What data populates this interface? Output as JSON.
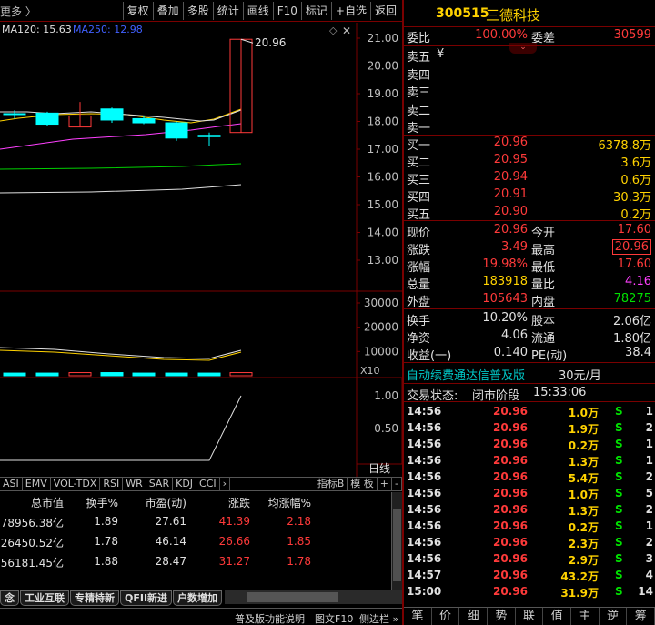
{
  "toolbar": {
    "more": "更多 〉",
    "buttons": [
      "复权",
      "叠加",
      "多股",
      "统计",
      "画线",
      "F10",
      "标记",
      "+自选",
      "返回"
    ]
  },
  "chart": {
    "ma120_label": "MA120: 15.63",
    "ma250_label": "MA250: 12.98",
    "price_axis": [
      "21.00",
      "20.00",
      "19.00",
      "18.00",
      "17.00",
      "16.00",
      "15.00",
      "14.00",
      "13.00"
    ],
    "high_marker": "20.96",
    "volume_axis": [
      "30000",
      "20000",
      "10000"
    ],
    "volume_unit": "X10",
    "indicator_axis": [
      "1.00",
      "0.50"
    ],
    "weekly_label": "日线",
    "colors": {
      "up": "#ff3a3a",
      "down": "#00ffff",
      "ma_white": "#e0e0e0",
      "ma_yellow": "#ffd200",
      "ma_magenta": "#ff40ff",
      "ma_green": "#00d000",
      "grid": "#7a0000"
    }
  },
  "indicator_tabs": [
    "ASI",
    "EMV",
    "VOL-TDX",
    "RSI",
    "WR",
    "SAR",
    "KDJ",
    "CCI",
    "›",
    "指标B",
    "模 板",
    "+",
    "-"
  ],
  "sector_table": {
    "headers": [
      "总市值",
      "换手%",
      "市盈(动)",
      "涨跌",
      "均涨幅%"
    ],
    "rows": [
      [
        "78956.38亿",
        "1.89",
        "27.61",
        "41.39",
        "2.18"
      ],
      [
        "26450.52亿",
        "1.78",
        "46.14",
        "26.66",
        "1.85"
      ],
      [
        "56181.45亿",
        "1.88",
        "28.47",
        "31.27",
        "1.78"
      ]
    ]
  },
  "sector_tabs": [
    "念",
    "工业互联",
    "专精特新",
    "QFII新进",
    "户数增加"
  ],
  "status_bar": {
    "left": "普及版功能说明",
    "mid": "图文F10",
    "right": "侧边栏 »"
  },
  "quote": {
    "code": "300515",
    "name": "三德科技",
    "weibi_label": "委比",
    "weibi": "100.00%",
    "weicha_label": "委差",
    "weicha": "30599",
    "sell_labels": [
      "卖五",
      "卖四",
      "卖三",
      "卖二",
      "卖一"
    ],
    "sell_extra": "¥",
    "buy": [
      {
        "label": "买一",
        "price": "20.96",
        "vol": "6378.8万"
      },
      {
        "label": "买二",
        "price": "20.95",
        "vol": "3.6万"
      },
      {
        "label": "买三",
        "price": "20.94",
        "vol": "0.6万"
      },
      {
        "label": "买四",
        "price": "20.91",
        "vol": "30.3万"
      },
      {
        "label": "买五",
        "price": "20.90",
        "vol": "0.2万"
      }
    ],
    "stats": [
      {
        "l1": "现价",
        "v1": "20.96",
        "l2": "今开",
        "v2": "17.60"
      },
      {
        "l1": "涨跌",
        "v1": "3.49",
        "l2": "最高",
        "v2": "20.96"
      },
      {
        "l1": "涨幅",
        "v1": "19.98%",
        "l2": "最低",
        "v2": "17.60"
      },
      {
        "l1": "总量",
        "v1": "183918",
        "l2": "量比",
        "v2": "4.16"
      },
      {
        "l1": "外盘",
        "v1": "105643",
        "l2": "内盘",
        "v2": "78275"
      }
    ],
    "fund": [
      {
        "l1": "换手",
        "v1": "10.20%",
        "l2": "股本",
        "v2": "2.06亿"
      },
      {
        "l1": "净资",
        "v1": "4.06",
        "l2": "流通",
        "v2": "1.80亿"
      },
      {
        "l1": "收益(一)",
        "v1": "0.140",
        "l2": "PE(动)",
        "v2": "38.4"
      }
    ],
    "ad_text": "自动续费通达信普及版",
    "ad_price": "30元/月",
    "trade_status_label": "交易状态:",
    "trade_status": "闭市阶段",
    "trade_time": "15:33:06"
  },
  "ticks": [
    [
      "14:56",
      "20.96",
      "1.0万",
      "S",
      "1"
    ],
    [
      "14:56",
      "20.96",
      "1.9万",
      "S",
      "2"
    ],
    [
      "14:56",
      "20.96",
      "0.2万",
      "S",
      "1"
    ],
    [
      "14:56",
      "20.96",
      "1.3万",
      "S",
      "1"
    ],
    [
      "14:56",
      "20.96",
      "5.4万",
      "S",
      "2"
    ],
    [
      "14:56",
      "20.96",
      "1.0万",
      "S",
      "5"
    ],
    [
      "14:56",
      "20.96",
      "1.3万",
      "S",
      "2"
    ],
    [
      "14:56",
      "20.96",
      "0.2万",
      "S",
      "1"
    ],
    [
      "14:56",
      "20.96",
      "2.3万",
      "S",
      "2"
    ],
    [
      "14:56",
      "20.96",
      "2.9万",
      "S",
      "3"
    ],
    [
      "14:57",
      "20.96",
      "43.2万",
      "S",
      "4"
    ],
    [
      "15:00",
      "20.96",
      "31.9万",
      "S",
      "14"
    ]
  ],
  "right_tabs": [
    "笔",
    "价",
    "细",
    "势",
    "联",
    "值",
    "主",
    "逆",
    "筹"
  ]
}
